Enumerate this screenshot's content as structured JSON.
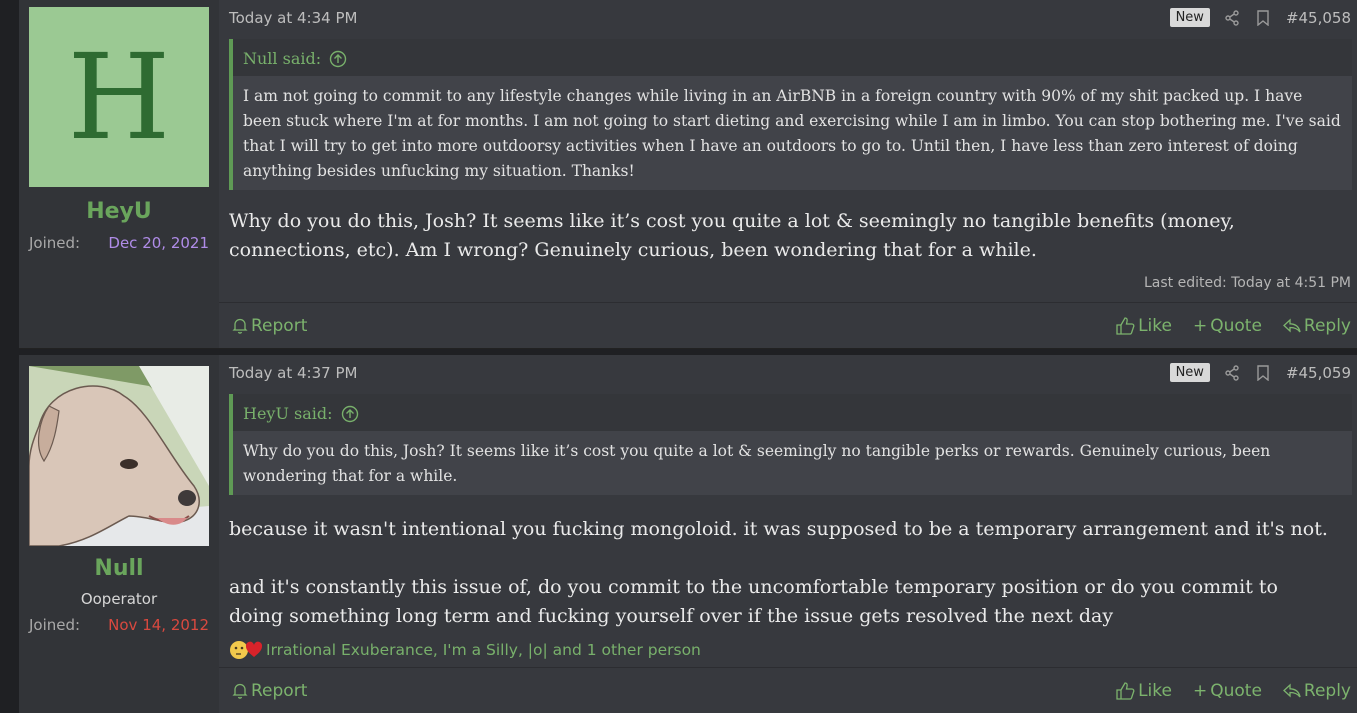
{
  "posts": [
    {
      "author": {
        "name": "HeyU",
        "avatar_letter": "H",
        "joined_label": "Joined:",
        "joined_date": "Dec 20, 2021",
        "joined_color": "#b08ce8"
      },
      "time": "Today at 4:34 PM",
      "badge": "New",
      "number": "#45,058",
      "quote": {
        "author": "Null said:",
        "text": "I am not going to commit to any lifestyle changes while living in an AirBNB in a foreign country with 90% of my shit packed up. I have been stuck where I'm at for months. I am not going to start dieting and exercising while I am in limbo. You can stop bothering me. I've said that I will try to get into more outdoorsy activities when I have an outdoors to go to. Until then, I have less than zero interest of doing anything besides unfucking my situation. Thanks!"
      },
      "message": "Why do you do this, Josh? It seems like it’s cost you quite a lot & seemingly no tangible benefits (money, connections, etc). Am I wrong? Genuinely curious, been wondering that for a while.",
      "last_edited": "Last edited: Today at 4:51 PM",
      "actions": {
        "report": "Report",
        "like": "Like",
        "quote": "Quote",
        "reply": "Reply"
      }
    },
    {
      "author": {
        "name": "Null",
        "title": "Ooperator",
        "joined_label": "Joined:",
        "joined_date": "Nov 14, 2012",
        "joined_color": "#d9493f"
      },
      "time": "Today at 4:37 PM",
      "badge": "New",
      "number": "#45,059",
      "quote": {
        "author": "HeyU said:",
        "text": "Why do you do this, Josh? It seems like it’s cost you quite a lot & seemingly no tangible perks or rewards. Genuinely curious, been wondering that for a while."
      },
      "message_p1": "because it wasn't intentional you fucking mongoloid. it was supposed to be a temporary arrangement and it's not.",
      "message_p2": "and it's constantly this issue of, do you commit to the uncomfortable temporary position or do you commit to doing something long term and fucking yourself over if the issue gets resolved the next day",
      "reactions": "Irrational Exuberance, I'm a Silly, |o| and 1 other person",
      "actions": {
        "report": "Report",
        "like": "Like",
        "quote": "Quote",
        "reply": "Reply"
      }
    }
  ],
  "colors": {
    "accent_green": "#7cb36d",
    "panel": "#37393e",
    "user_panel": "#323438"
  },
  "icons": [
    "share-icon",
    "bookmark-icon",
    "bell-icon",
    "thumbs-up-icon",
    "plus-icon",
    "reply-arrow-icon",
    "up-arrow-circle-icon",
    "thinking-face-icon",
    "heart-icon"
  ]
}
